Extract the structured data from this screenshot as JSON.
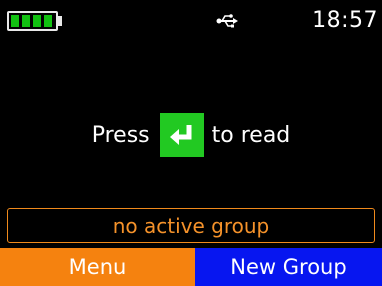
{
  "status_bar": {
    "battery_level": 1.0,
    "battery_icon": "battery-full-icon",
    "usb_icon": "usb-icon",
    "time": "18:57"
  },
  "prompt": {
    "before": "Press",
    "icon": "enter-key-icon",
    "after": "to read"
  },
  "status": {
    "text": "no active group"
  },
  "softkeys": {
    "left_label": "Menu",
    "right_label": "New Group"
  },
  "colors": {
    "background": "#000000",
    "battery_fill": "#10c010",
    "enter_key": "#22c922",
    "status_accent": "#f5922a",
    "menu_button": "#f5820f",
    "new_group_button": "#0716f0"
  }
}
